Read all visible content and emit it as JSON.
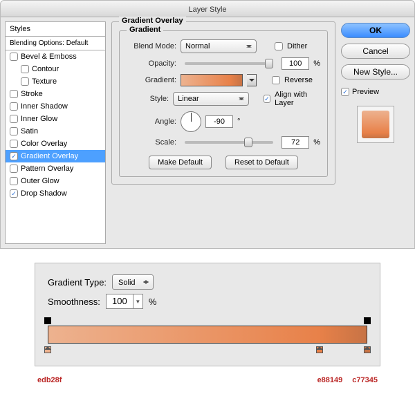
{
  "dialog": {
    "title": "Layer Style",
    "styles_header": "Styles",
    "blending_header": "Blending Options: Default",
    "style_items": [
      {
        "label": "Bevel & Emboss",
        "checked": false,
        "indent": false
      },
      {
        "label": "Contour",
        "checked": false,
        "indent": true
      },
      {
        "label": "Texture",
        "checked": false,
        "indent": true
      },
      {
        "label": "Stroke",
        "checked": false,
        "indent": false
      },
      {
        "label": "Inner Shadow",
        "checked": false,
        "indent": false
      },
      {
        "label": "Inner Glow",
        "checked": false,
        "indent": false
      },
      {
        "label": "Satin",
        "checked": false,
        "indent": false
      },
      {
        "label": "Color Overlay",
        "checked": false,
        "indent": false
      },
      {
        "label": "Gradient Overlay",
        "checked": true,
        "indent": false,
        "selected": true
      },
      {
        "label": "Pattern Overlay",
        "checked": false,
        "indent": false
      },
      {
        "label": "Outer Glow",
        "checked": false,
        "indent": false
      },
      {
        "label": "Drop Shadow",
        "checked": true,
        "indent": false
      }
    ]
  },
  "panel": {
    "section_title": "Gradient Overlay",
    "group_title": "Gradient",
    "blend_mode_label": "Blend Mode:",
    "blend_mode_value": "Normal",
    "dither_label": "Dither",
    "dither_checked": false,
    "opacity_label": "Opacity:",
    "opacity_value": "100",
    "opacity_unit": "%",
    "gradient_label": "Gradient:",
    "reverse_label": "Reverse",
    "reverse_checked": false,
    "style_label": "Style:",
    "style_value": "Linear",
    "align_label": "Align with Layer",
    "align_checked": true,
    "angle_label": "Angle:",
    "angle_value": "-90",
    "angle_unit": "°",
    "scale_label": "Scale:",
    "scale_value": "72",
    "scale_unit": "%",
    "make_default": "Make Default",
    "reset_default": "Reset to Default"
  },
  "buttons": {
    "ok": "OK",
    "cancel": "Cancel",
    "new_style": "New Style...",
    "preview_label": "Preview",
    "preview_checked": true
  },
  "editor": {
    "type_label": "Gradient Type:",
    "type_value": "Solid",
    "smooth_label": "Smoothness:",
    "smooth_value": "100",
    "smooth_unit": "%",
    "stops": {
      "opacity": [
        {
          "pos": 0
        },
        {
          "pos": 100
        }
      ],
      "color": [
        {
          "pos": 0,
          "hex": "edb28f"
        },
        {
          "pos": 85,
          "hex": "e88149"
        },
        {
          "pos": 100,
          "hex": "c77345"
        }
      ]
    }
  },
  "hex_labels": {
    "left": "edb28f",
    "mid": "e88149",
    "right": "c77345"
  },
  "colors": {
    "grad_start": "#edb28f",
    "grad_mid": "#e88149",
    "grad_end": "#c77345",
    "accent": "#4da0ff"
  }
}
